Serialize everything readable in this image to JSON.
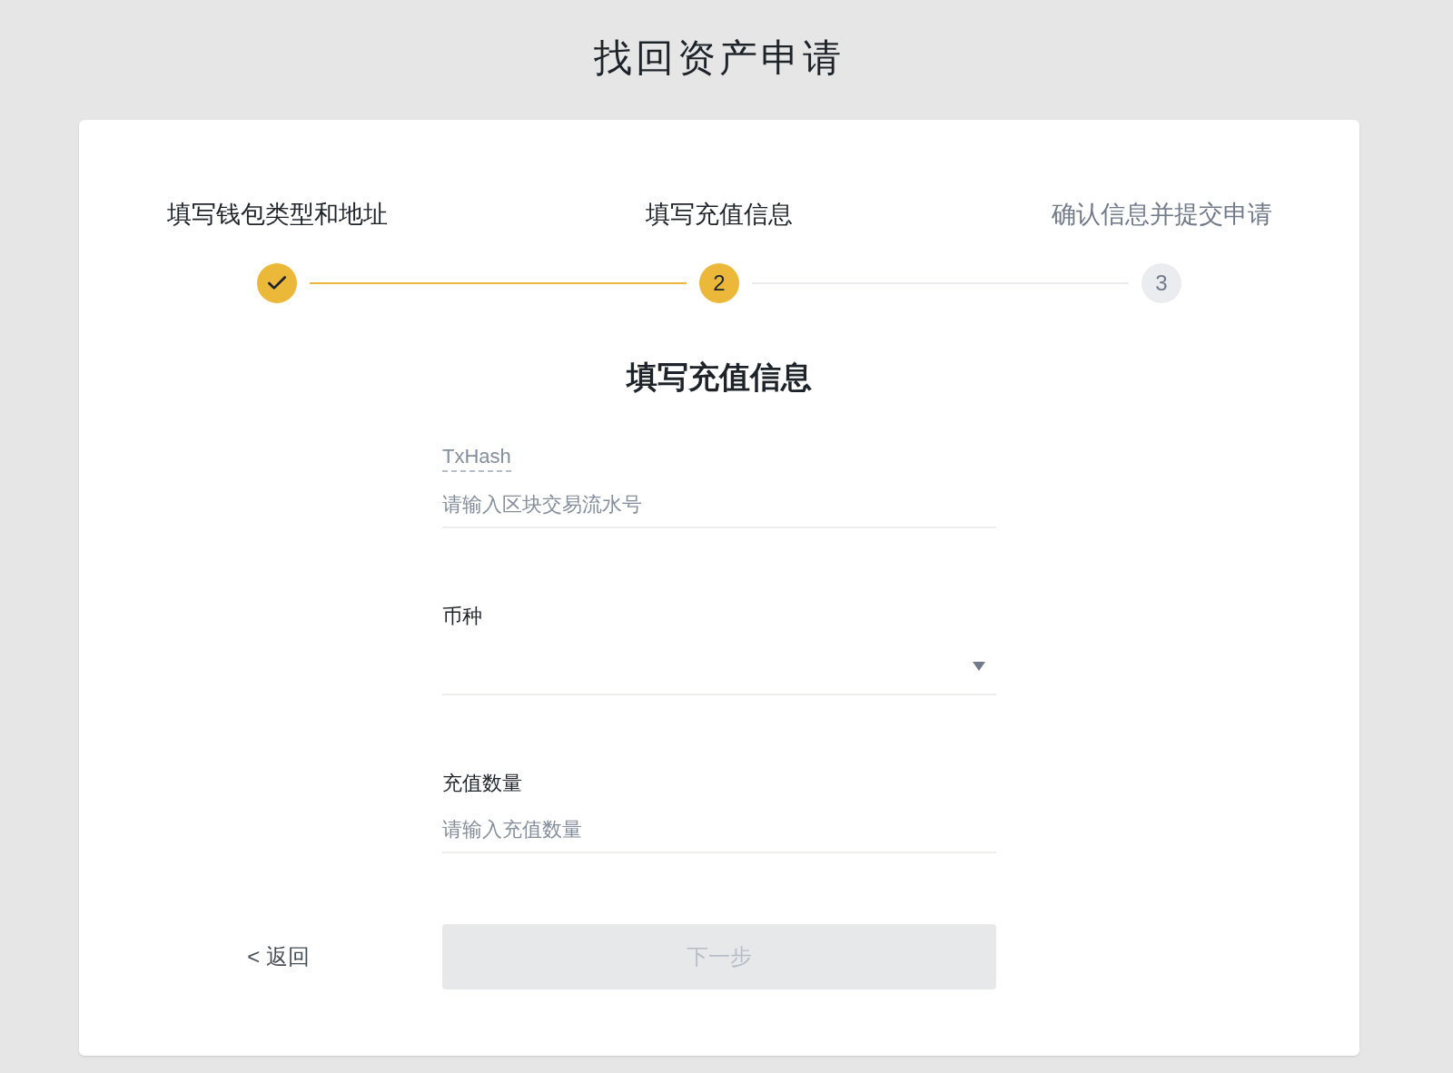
{
  "page_title": "找回资产申请",
  "steps": [
    {
      "label": "填写钱包类型和地址",
      "kind": "done"
    },
    {
      "label": "填写充值信息",
      "number": "2",
      "kind": "active"
    },
    {
      "label": "确认信息并提交申请",
      "number": "3",
      "kind": "pending"
    }
  ],
  "form": {
    "heading": "填写充值信息",
    "fields": [
      {
        "kind": "input",
        "label": "TxHash",
        "label_hint": true,
        "placeholder": "请输入区块交易流水号"
      },
      {
        "kind": "select",
        "label": "币种"
      },
      {
        "kind": "input",
        "label": "充值数量",
        "label_hint": false,
        "placeholder": "请输入充值数量"
      }
    ],
    "back_link": "< 返回",
    "next_button": {
      "label": "下一步",
      "disabled": true
    }
  }
}
